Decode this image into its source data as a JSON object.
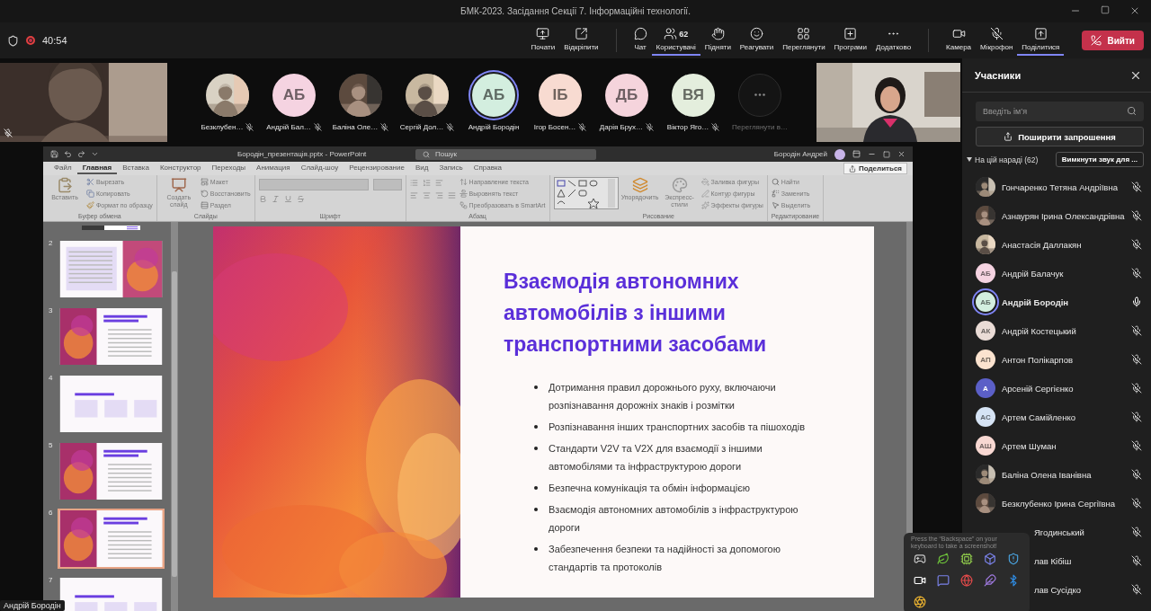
{
  "window": {
    "title": "БМК-2023. Засідання Секції 7. Інформаційні технології."
  },
  "meeting_bar": {
    "timer": "40:54",
    "recording": true,
    "groups": [
      {
        "buttons": [
          {
            "kind": "present",
            "label": "Почати",
            "selected": false
          },
          {
            "kind": "popout",
            "label": "Відкріпити",
            "selected": false
          }
        ]
      },
      {
        "buttons": [
          {
            "kind": "chat",
            "label": "Чат",
            "selected": false
          },
          {
            "kind": "people",
            "label": "Користувачі",
            "badge": "62",
            "selected": true
          },
          {
            "kind": "hand",
            "label": "Підняти",
            "selected": false
          },
          {
            "kind": "react",
            "label": "Реагувати",
            "selected": false
          },
          {
            "kind": "view",
            "label": "Переглянути",
            "selected": false
          },
          {
            "kind": "apps",
            "label": "Програми",
            "selected": false
          },
          {
            "kind": "more",
            "label": "Додатково",
            "selected": false
          }
        ]
      },
      {
        "buttons": [
          {
            "kind": "camera",
            "label": "Камера",
            "selected": false
          },
          {
            "kind": "mic-off",
            "label": "Мікрофон",
            "selected": false
          },
          {
            "kind": "share",
            "label": "Поділитися",
            "selected": true
          }
        ]
      }
    ],
    "leave": "Вийти"
  },
  "gallery": [
    {
      "name": "Безклубен…",
      "muted": true,
      "speaking": false
    },
    {
      "kind": "initials",
      "initials": "АБ",
      "color": "#f5d3e1",
      "name": "Андрій Бал…",
      "muted": true,
      "speaking": false
    },
    {
      "name": "Баліна Оле…",
      "muted": true,
      "speaking": false
    },
    {
      "name": "Сергій Дол…",
      "muted": true,
      "speaking": false
    },
    {
      "kind": "initials",
      "initials": "АБ",
      "color": "#d3eedf",
      "name": "Андрій Бородін",
      "muted": false,
      "speaking": true
    },
    {
      "kind": "initials",
      "initials": "ІБ",
      "color": "#f8dbd1",
      "name": "Ігор Босен…",
      "muted": true,
      "speaking": false
    },
    {
      "kind": "initials",
      "initials": "ДБ",
      "color": "#f5d4dc",
      "name": "Дарія Брух…",
      "muted": true,
      "speaking": false
    },
    {
      "kind": "initials",
      "initials": "ВЯ",
      "color": "#e4eedd",
      "name": "Віктор Яго…",
      "muted": true,
      "speaking": false
    }
  ],
  "gallery_more": "Переглянути в…",
  "video_left": {
    "muted": true
  },
  "presenter_tag": "Андрій Бородін",
  "powerpoint": {
    "file": "Бородін_презентація.pptx - PowerPoint",
    "search": "Пошук",
    "user": "Бородін Андрей",
    "share": "Поделиться",
    "tabs": [
      {
        "label": "Файл",
        "selected": false
      },
      {
        "label": "Главная",
        "selected": true
      },
      {
        "label": "Вставка",
        "selected": false
      },
      {
        "label": "Конструктор",
        "selected": false
      },
      {
        "label": "Переходы",
        "selected": false
      },
      {
        "label": "Анимация",
        "selected": false
      },
      {
        "label": "Слайд-шоу",
        "selected": false
      },
      {
        "label": "Рецензирование",
        "selected": false
      },
      {
        "label": "Вид",
        "selected": false
      },
      {
        "label": "Запись",
        "selected": false
      },
      {
        "label": "Справка",
        "selected": false
      }
    ],
    "ribbon": [
      {
        "label": "Буфер обмена",
        "items": [
          {
            "kind": "large",
            "label": "Вставить"
          },
          {
            "kind": "small",
            "label": "Вырезать"
          },
          {
            "kind": "small",
            "label": "Копировать"
          },
          {
            "kind": "small",
            "label": "Формат по образцу"
          }
        ]
      },
      {
        "label": "Слайды",
        "items": [
          {
            "kind": "large",
            "label": "Создать слайд"
          },
          {
            "kind": "small",
            "label": "Макет"
          },
          {
            "kind": "small",
            "label": "Восстановить"
          },
          {
            "kind": "small",
            "label": "Раздел"
          }
        ]
      },
      {
        "label": "Шрифт",
        "items": [
          {
            "kind": "font"
          }
        ]
      },
      {
        "label": "Абзац",
        "items": [
          {
            "kind": "paragraph"
          },
          {
            "kind": "small",
            "label": "Направление текста"
          },
          {
            "kind": "small",
            "label": "Выровнять текст"
          },
          {
            "kind": "small",
            "label": "Преобразовать в SmartArt"
          }
        ]
      },
      {
        "label": "Рисование",
        "items": [
          {
            "kind": "shapes"
          },
          {
            "kind": "large",
            "label": "Упорядочить"
          },
          {
            "kind": "large",
            "label": "Экспресс-стили"
          },
          {
            "kind": "small",
            "label": "Заливка фигуры"
          },
          {
            "kind": "small",
            "label": "Контур фигуры"
          },
          {
            "kind": "small",
            "label": "Эффекты фигуры"
          }
        ]
      },
      {
        "label": "Редактирование",
        "items": [
          {
            "kind": "small",
            "label": "Найти"
          },
          {
            "kind": "small",
            "label": "Заменить"
          },
          {
            "kind": "small",
            "label": "Выделить"
          }
        ]
      }
    ],
    "slides": [
      {
        "kind": "partial",
        "selected": false
      },
      {
        "number": "2",
        "kind": "image-right",
        "selected": false
      },
      {
        "number": "3",
        "kind": "image-left",
        "selected": false
      },
      {
        "number": "4",
        "kind": "boxes",
        "selected": false
      },
      {
        "number": "5",
        "kind": "image-left",
        "selected": false
      },
      {
        "number": "6",
        "kind": "image-left",
        "selected": true
      },
      {
        "number": "7",
        "kind": "boxes",
        "selected": false
      }
    ],
    "slide": {
      "title": "Взаємодія автономних автомобілів з іншими транспортними засобами",
      "bullets": [
        "Дотримання правил дорожнього руху, включаючи розпізнавання дорожніх знаків і розмітки",
        "Розпізнавання інших транспортних засобів та пішоходів",
        "Стандарти V2V та V2X для взаємодії з іншими автомобілями та інфраструктурою дороги",
        "Безпечна комунікація та обмін інформацією",
        "Взаємодія автономних автомобілів з інфраструктурою дороги",
        "Забезпечення безпеки та надійності за допомогою стандартів та протоколів"
      ]
    }
  },
  "participants": {
    "title": "Учасники",
    "search_placeholder": "Введіть ім’я",
    "invite": "Поширити запрошення",
    "section": "На цій нараді (62)",
    "expanded": true,
    "mute_all": "Вимкнути звук для ...",
    "people": [
      {
        "name": "Гончаренко Тетяна Андріївна",
        "muted": true,
        "speaking": false,
        "covered": false
      },
      {
        "name": "Азнаурян Ірина Олександрівна",
        "muted": true,
        "speaking": false,
        "covered": false
      },
      {
        "name": "Анастасія Даллакян",
        "muted": true,
        "speaking": false,
        "covered": false
      },
      {
        "kind": "initials",
        "initials": "АБ",
        "color": "#f5d3e1",
        "name": "Андрій Балачук",
        "muted": true,
        "speaking": false,
        "covered": false
      },
      {
        "kind": "initials",
        "initials": "АБ",
        "color": "#d3eedf",
        "name": "Андрій Бородін",
        "muted": false,
        "speaking": true,
        "covered": false
      },
      {
        "kind": "initials",
        "initials": "АК",
        "color": "#eadcd6",
        "name": "Андрій Костецький",
        "muted": true,
        "speaking": false,
        "covered": false
      },
      {
        "kind": "initials",
        "initials": "АП",
        "color": "#fbe3cf",
        "name": "Антон Полікарпов",
        "muted": true,
        "speaking": false,
        "covered": false
      },
      {
        "kind": "initials",
        "initials": "А",
        "color": "#5b5fc7",
        "name": "Арсеній Сергієнко",
        "muted": true,
        "speaking": false,
        "covered": false
      },
      {
        "kind": "initials",
        "initials": "АС",
        "color": "#d5e3f4",
        "name": "Артем Самійленко",
        "muted": true,
        "speaking": false,
        "covered": false
      },
      {
        "kind": "initials",
        "initials": "АШ",
        "color": "#f8d8d2",
        "name": "Артем Шуман",
        "muted": true,
        "speaking": false,
        "covered": false
      },
      {
        "name": "Баліна Олена Іванівна",
        "muted": true,
        "speaking": false,
        "covered": false
      },
      {
        "name": "Безклубенко Ірина Сергіївна",
        "muted": true,
        "speaking": false,
        "covered": false
      },
      {
        "name": "Ягодинський",
        "muted": true,
        "speaking": false,
        "covered": true
      },
      {
        "name": "лав Кібіш",
        "muted": true,
        "speaking": false,
        "covered": true
      },
      {
        "name": "лав Сусідко",
        "muted": true,
        "speaking": false,
        "covered": true
      }
    ]
  },
  "tray": {
    "tooltip": "Press the “Backspace” on your keyboard to take a screenshot!",
    "icons": [
      {
        "kind": "gamepad"
      },
      {
        "kind": "leaf"
      },
      {
        "kind": "chip"
      },
      {
        "kind": "box"
      },
      {
        "kind": "shield"
      },
      {
        "kind": "video"
      },
      {
        "kind": "chat"
      },
      {
        "kind": "globe"
      },
      {
        "kind": "feather"
      },
      {
        "kind": "bluetooth"
      },
      {
        "kind": "aperture"
      }
    ]
  }
}
